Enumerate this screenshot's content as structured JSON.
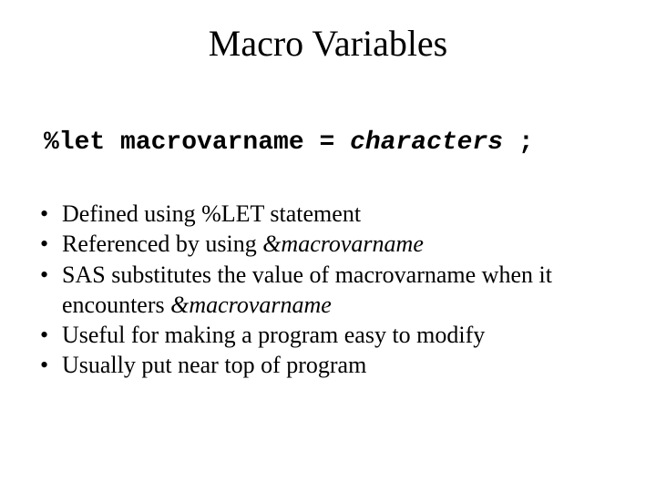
{
  "title": "Macro Variables",
  "code": {
    "part1": "%let macrovarname = ",
    "italic": "characters",
    "part2": " ;"
  },
  "bullets": {
    "b1": "Defined using %LET statement",
    "b2a": "Referenced by using ",
    "b2b": "&macrovarname",
    "b3a": "SAS substitutes the value of macrovarname when it encounters ",
    "b3b": "&macrovarname",
    "b4": "Useful for making a program easy to modify",
    "b5": "Usually put near top of program"
  }
}
